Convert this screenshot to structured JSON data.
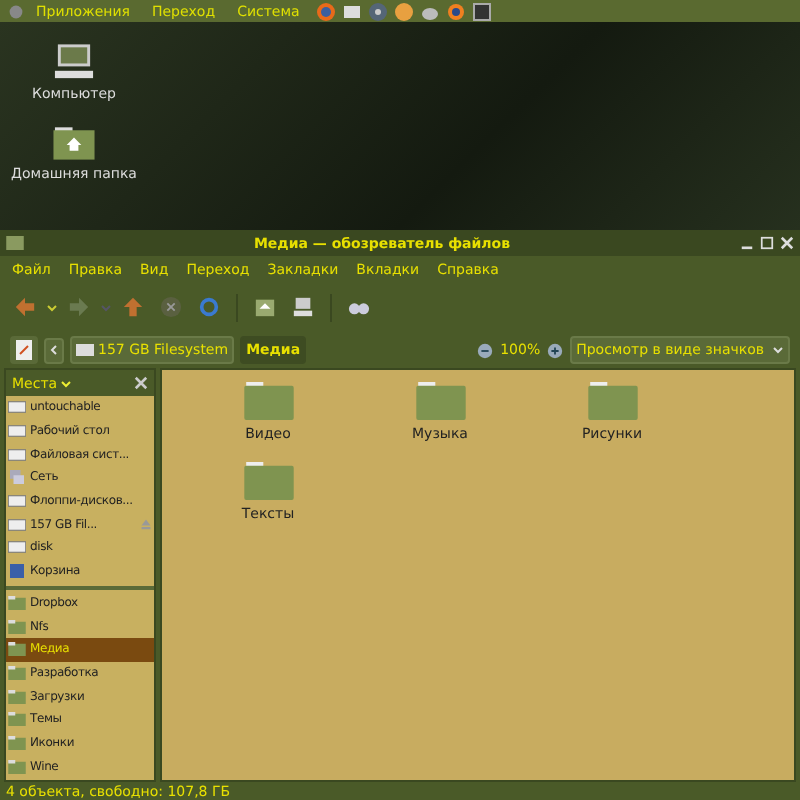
{
  "top_panel": {
    "menus": [
      "Приложения",
      "Переход",
      "Система"
    ]
  },
  "desktop": {
    "icons": [
      {
        "kind": "computer",
        "label": "Компьютер"
      },
      {
        "kind": "home",
        "label": "Домашняя папка"
      }
    ]
  },
  "window": {
    "title": "Медиа — обозреватель файлов",
    "menu": [
      "Файл",
      "Правка",
      "Вид",
      "Переход",
      "Закладки",
      "Вкладки",
      "Справка"
    ],
    "location": {
      "path": [
        {
          "label": "157 GB Filesystem",
          "selected": false
        },
        {
          "label": "Медиа",
          "selected": true
        }
      ],
      "zoom": "100%",
      "view": "Просмотр в виде значков"
    },
    "sidebar": {
      "title": "Места",
      "items": [
        {
          "kind": "device",
          "label": "untouchable",
          "selected": false,
          "eject": false
        },
        {
          "kind": "device",
          "label": "Рабочий стол",
          "selected": false,
          "eject": false
        },
        {
          "kind": "device",
          "label": "Файловая сист...",
          "selected": false,
          "eject": false
        },
        {
          "kind": "network",
          "label": "Сеть",
          "selected": false,
          "eject": false
        },
        {
          "kind": "device",
          "label": "Флоппи-дисков...",
          "selected": false,
          "eject": false
        },
        {
          "kind": "device",
          "label": "157 GB Fil...",
          "selected": false,
          "eject": true
        },
        {
          "kind": "device",
          "label": "disk",
          "selected": false,
          "eject": false
        },
        {
          "kind": "trash",
          "label": "Корзина",
          "selected": false,
          "eject": false
        },
        {
          "kind": "folder",
          "label": "Dropbox",
          "selected": false,
          "eject": false
        },
        {
          "kind": "folder",
          "label": "Nfs",
          "selected": false,
          "eject": false
        },
        {
          "kind": "folder",
          "label": "Медиа",
          "selected": true,
          "eject": false
        },
        {
          "kind": "folder",
          "label": "Разработка",
          "selected": false,
          "eject": false
        },
        {
          "kind": "folder",
          "label": "Загрузки",
          "selected": false,
          "eject": false
        },
        {
          "kind": "folder",
          "label": "Темы",
          "selected": false,
          "eject": false
        },
        {
          "kind": "folder",
          "label": "Иконки",
          "selected": false,
          "eject": false
        },
        {
          "kind": "folder",
          "label": "Wine",
          "selected": false,
          "eject": false
        }
      ]
    },
    "files": [
      "Видео",
      "Музыка",
      "Рисунки",
      "Тексты"
    ],
    "status_bar": "4 объекта, свободно: 107,8 ГБ"
  }
}
